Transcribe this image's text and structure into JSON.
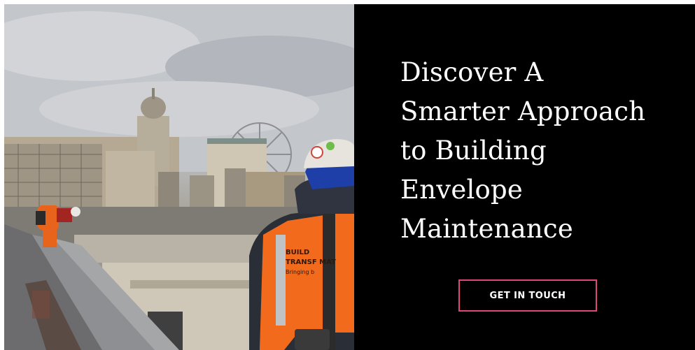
{
  "hero": {
    "headline_lines": [
      "Discover A",
      "Smarter Approach",
      "to Building",
      "Envelope",
      "Maintenance"
    ],
    "cta_label": "GET IN TOUCH",
    "background_color": "#000000",
    "text_color": "#ffffff",
    "cta_border_color": "#e0457b"
  },
  "photo": {
    "vest_text_line1": "BUILD",
    "vest_text_line2": "TRANSF MAT",
    "vest_text_line3": "Bringing b",
    "vest_color": "#f26a1b"
  }
}
